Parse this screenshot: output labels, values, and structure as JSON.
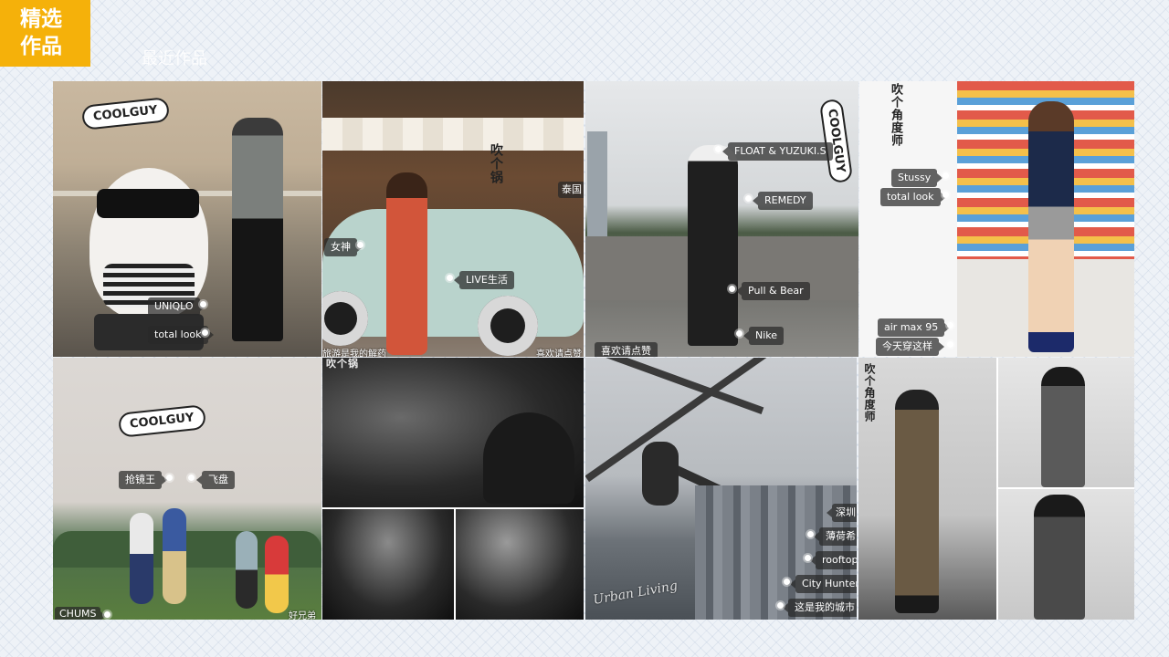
{
  "header": {
    "badge_line1": "精选",
    "badge_line2": "作品",
    "subtitle": "最近作品"
  },
  "photos": {
    "p1": {
      "sticker": "COOLGUY",
      "tags": [
        "UNIQLO",
        "total look"
      ]
    },
    "p2": {
      "sticker": "吹个锅",
      "tags": [
        "泰国",
        "女神",
        "LIVE生活",
        "旅游是我的解药",
        "喜欢请点赞"
      ]
    },
    "p3": {
      "sticker": "COOLGUY",
      "tags": [
        "FLOAT & YUZUKI.S",
        "REMEDY",
        "Pull & Bear",
        "Nike",
        "喜欢请点赞"
      ]
    },
    "p4": {
      "sticker": "吹个角度师",
      "tags": [
        "Stussy",
        "total look",
        "air max 95",
        "今天穿这样"
      ]
    },
    "p5": {
      "sticker": "COOLGUY",
      "tags": [
        "抢镜王",
        "飞盘",
        "CHUMS",
        "好兄弟"
      ]
    },
    "p6": {
      "sticker": "吹个锅"
    },
    "p7": {
      "tags": [
        "深圳",
        "薄荷希",
        "rooftop",
        "City Hunter",
        "这是我的城市"
      ],
      "signature": "Urban Living"
    },
    "p8": {
      "sticker": "吹个角度师"
    }
  },
  "colors": {
    "accent": "#f5b10a",
    "tag_bg": "#282828"
  }
}
